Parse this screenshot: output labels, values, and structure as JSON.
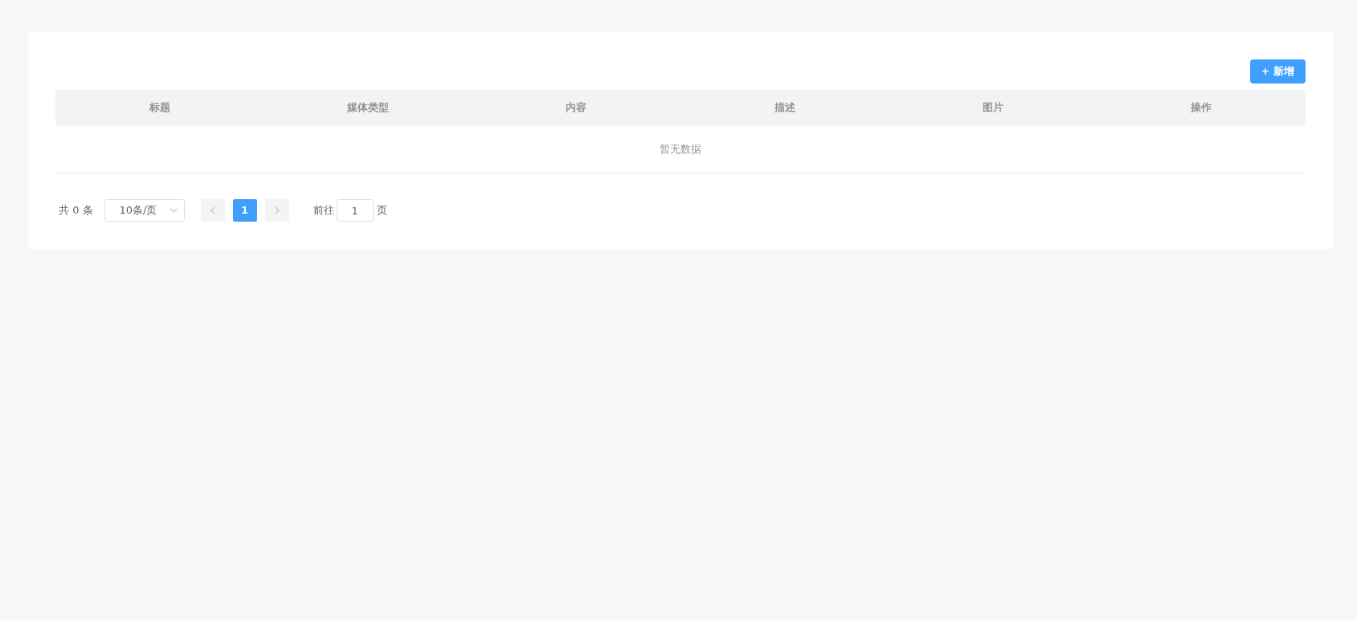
{
  "toolbar": {
    "add_button": "+ 新增"
  },
  "table": {
    "columns": [
      "标题",
      "媒体类型",
      "内容",
      "描述",
      "图片",
      "操作"
    ],
    "empty_text": "暂无数据"
  },
  "pagination": {
    "total": "共 0 条",
    "page_size": "10条/页",
    "pages": [
      {
        "label": "1",
        "selected": true
      }
    ],
    "prev_disabled": true,
    "next_disabled": true,
    "goto_label": "前往",
    "goto_value": "1",
    "goto_suffix": "页"
  }
}
